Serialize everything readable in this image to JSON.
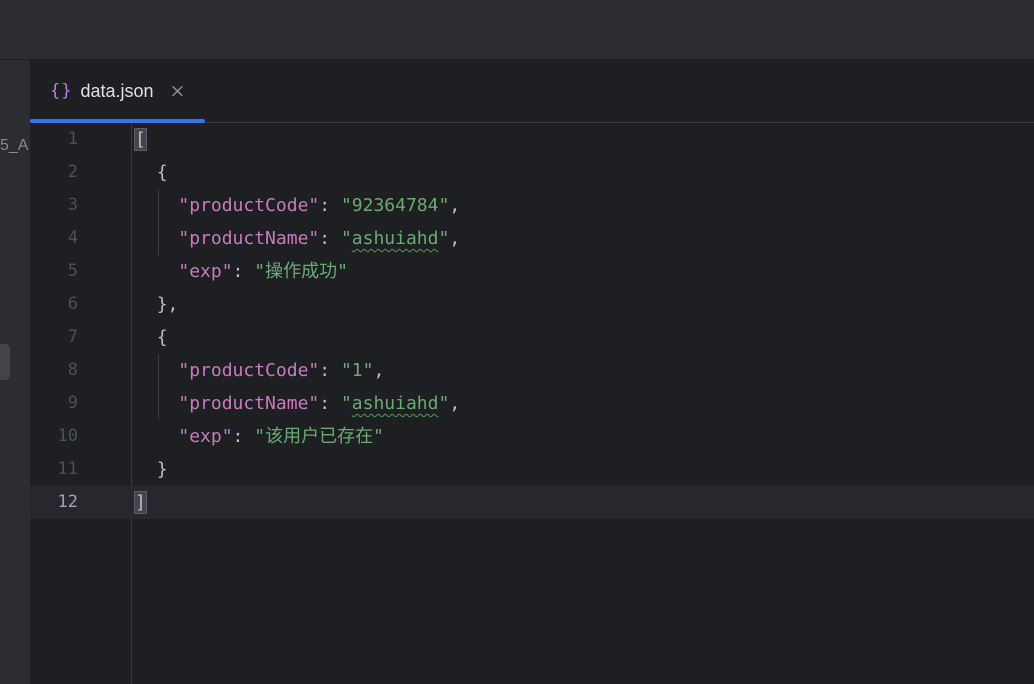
{
  "left_panel": {
    "clipped_text": "5_A"
  },
  "tab": {
    "icon": "{}",
    "icon_name": "json-file-icon",
    "label": "data.json",
    "close": "×"
  },
  "editor": {
    "current_line": 12,
    "lines": [
      {
        "num": "1"
      },
      {
        "num": "2"
      },
      {
        "num": "3"
      },
      {
        "num": "4"
      },
      {
        "num": "5"
      },
      {
        "num": "6"
      },
      {
        "num": "7"
      },
      {
        "num": "8"
      },
      {
        "num": "9"
      },
      {
        "num": "10"
      },
      {
        "num": "11"
      },
      {
        "num": "12"
      }
    ],
    "content": {
      "open_array": "[",
      "close_array": "]",
      "open_obj": "{",
      "close_obj_comma": "},",
      "close_obj": "}",
      "colon": ": ",
      "comma": ",",
      "quote": "\"",
      "items": [
        {
          "k1": "\"productCode\"",
          "v1": "\"92364784\"",
          "k2": "\"productName\"",
          "v2": "ashuiahd",
          "k3": "\"exp\"",
          "v3": "\"操作成功\""
        },
        {
          "k1": "\"productCode\"",
          "v1": "\"1\"",
          "k2": "\"productName\"",
          "v2": "ashuiahd",
          "k3": "\"exp\"",
          "v3": "\"该用户已存在\""
        }
      ]
    }
  },
  "colors": {
    "background": "#1e1f22",
    "key": "#c77dbb",
    "string": "#6aab73",
    "punctuation": "#bcbec4",
    "tab_accent": "#3574f0"
  }
}
